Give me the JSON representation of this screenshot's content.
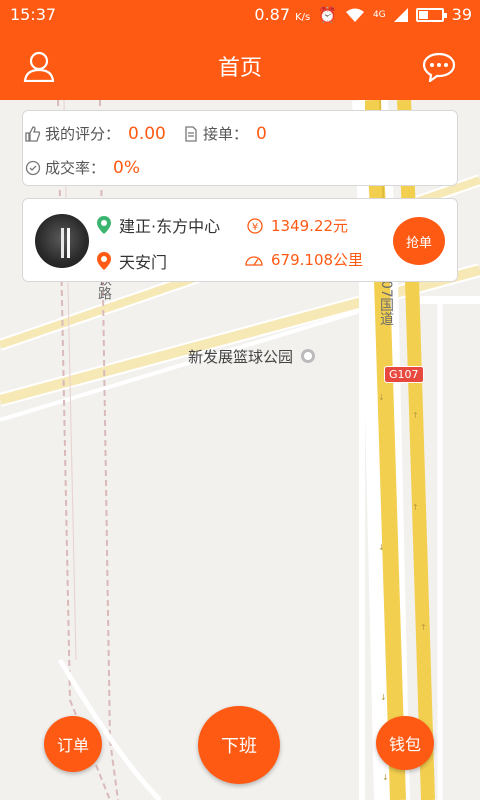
{
  "status_bar": {
    "time": "15:37",
    "network_speed": "0.87",
    "network_unit": "K/s",
    "signal_label": "4G",
    "battery": "39",
    "battery_level": 0.39
  },
  "header": {
    "title": "首页",
    "left_icon": "profile-icon",
    "right_icon": "chat-icon"
  },
  "stats": {
    "rating_label": "我的评分：",
    "rating_value": "0.00",
    "orders_label": "接单：",
    "orders_value": "0",
    "rate_label": "成交率：",
    "rate_value": "0%"
  },
  "order": {
    "from": "建正·东方中心",
    "to": "天安门",
    "price": "1349.22元",
    "distance": "679.108公里",
    "grab_label": "抢单"
  },
  "map": {
    "park_label": "新发展篮球公园",
    "road_tag": "G107",
    "rail_label": "铁路",
    "highway_label": "07国道"
  },
  "bottom": {
    "orders_label": "订单",
    "offduty_label": "下班",
    "wallet_label": "钱包"
  },
  "colors": {
    "accent": "#ff5a14",
    "pin_green": "#3bb46f"
  }
}
